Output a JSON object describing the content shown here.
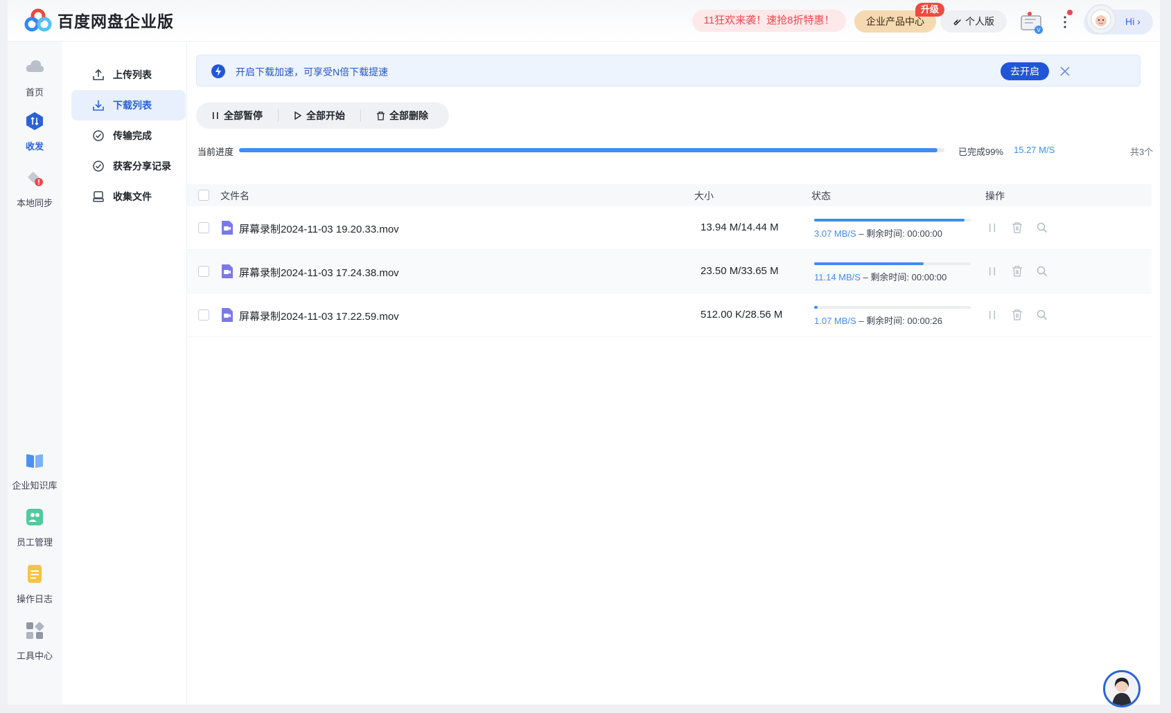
{
  "header": {
    "app_title": "百度网盘企业版",
    "promo_text": "11狂欢来袭！速抢8折特惠！",
    "enterprise_center": "企业产品中心",
    "upgrade_badge": "升级",
    "personal_edition": "个人版",
    "greeting": "Hi"
  },
  "rail": {
    "items": [
      {
        "label": "首页",
        "icon": "cloud-home-icon"
      },
      {
        "label": "收发",
        "icon": "transfer-icon",
        "active": true
      },
      {
        "label": "本地同步",
        "icon": "sync-icon"
      },
      {
        "label": "企业知识库",
        "icon": "knowledge-base-icon"
      },
      {
        "label": "员工管理",
        "icon": "staff-icon"
      },
      {
        "label": "操作日志",
        "icon": "log-icon"
      },
      {
        "label": "工具中心",
        "icon": "tools-icon"
      }
    ]
  },
  "submenu": {
    "items": [
      {
        "label": "上传列表",
        "icon": "upload-icon"
      },
      {
        "label": "下载列表",
        "icon": "download-icon",
        "active": true
      },
      {
        "label": "传输完成",
        "icon": "check-circle-icon"
      },
      {
        "label": "获客分享记录",
        "icon": "check-circle-icon"
      },
      {
        "label": "收集文件",
        "icon": "collect-icon"
      }
    ]
  },
  "banner": {
    "text": "开启下载加速，可享受N倍下载提速",
    "button": "去开启"
  },
  "toolbar": {
    "pause_all": "全部暂停",
    "start_all": "全部开始",
    "delete_all": "全部删除"
  },
  "progress": {
    "label": "当前进度",
    "percent": 99,
    "done_text": "已完成99%",
    "speed": "15.27 M/S",
    "total": "共3个"
  },
  "table": {
    "columns": {
      "name": "文件名",
      "size": "大小",
      "status": "状态",
      "ops": "操作"
    },
    "rows": [
      {
        "name": "屏幕录制2024-11-03 19.20.33.mov",
        "size": "13.94 M/14.44 M",
        "progress": 0.96,
        "speed": "3.07 MB/S",
        "remaining": "– 剩余时间: 00:00:00"
      },
      {
        "name": "屏幕录制2024-11-03 17.24.38.mov",
        "size": "23.50 M/33.65 M",
        "progress": 0.7,
        "speed": "11.14 MB/S",
        "remaining": "– 剩余时间: 00:00:00"
      },
      {
        "name": "屏幕录制2024-11-03 17.22.59.mov",
        "size": "512.00 K/28.56 M",
        "progress": 0.02,
        "speed": "1.07 MB/S",
        "remaining": "– 剩余时间: 00:00:26"
      }
    ]
  },
  "colors": {
    "accent": "#2962d9",
    "progress": "#3f8cf2",
    "promo_red": "#f0474c"
  }
}
